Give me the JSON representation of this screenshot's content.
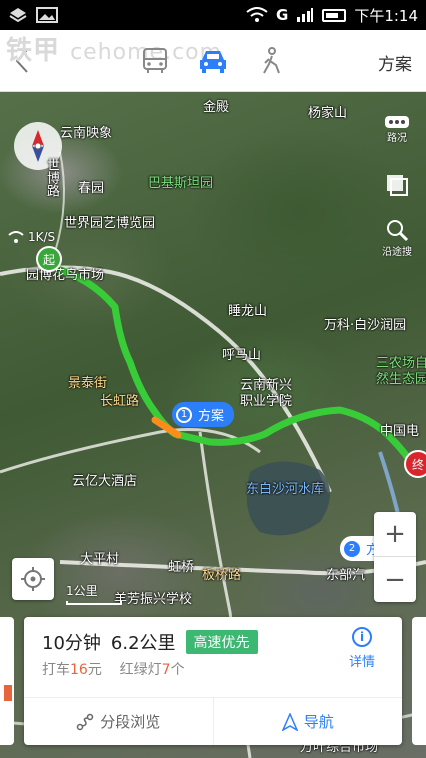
{
  "status_bar": {
    "network": "G",
    "time": "下午1:14"
  },
  "watermark": {
    "brand": "铁甲",
    "domain": "cehome.com"
  },
  "topnav": {
    "plan_label": "方案"
  },
  "map": {
    "speed": "1K/S",
    "labels": {
      "jindian": "金殿",
      "yangjiashan": "杨家山",
      "yunnan_yingxiang": "云南映象",
      "shuangshao": "世博路",
      "chunyuan": "春园",
      "pakistan_garden": "巴基斯坦园",
      "expo_garden": "世界园艺博览园",
      "yuanbo_market": "园博花鸟市场",
      "shuilong_shan": "睡龙山",
      "wankebaisha": "万科·白沙润园",
      "humashan": "呼马山",
      "yunnan_xinxing": "云南新兴",
      "zhiye_xueyuan": "职业学院",
      "sannong": "三农场自",
      "ziran": "然生态园",
      "jintai": "景泰街",
      "changchun": "长虹路",
      "zhongguo_dian": "中国电",
      "yunyi_hotel": "云亿大酒店",
      "dongbai_reservoir": "东白沙河水库",
      "dapingcun": "大平村",
      "hongqiao": "虹桥",
      "dongbu": "东部汽",
      "xingxing_school": "羊芳振兴学校",
      "wanzhong": "万叶综合市场",
      "banqiao": "板桥路"
    },
    "road_conditions_label": "路况",
    "street_view_label": "沿途搜",
    "start_label": "起",
    "end_label": "终",
    "scale_label": "1公里",
    "zoom_in": "+",
    "zoom_out": "−",
    "route_tags": {
      "plan1_num": "1",
      "plan1_label": "方案",
      "plan2_num": "2",
      "plan2_label": "方"
    }
  },
  "route_card": {
    "duration": "10分钟",
    "distance": "6.2公里",
    "tag": "高速优先",
    "taxi_prefix": "打车",
    "taxi_price": "16",
    "taxi_unit": "元",
    "lights_prefix": "红绿灯",
    "lights_count": "7",
    "lights_unit": "个",
    "detail_label": "详情",
    "segment_label": "分段浏览",
    "navigate_label": "导航"
  },
  "colors": {
    "route_green": "#3cd03c",
    "accent_blue": "#2d7ff9",
    "badge_green": "#3cb873",
    "highlight_orange": "#e8643a"
  }
}
